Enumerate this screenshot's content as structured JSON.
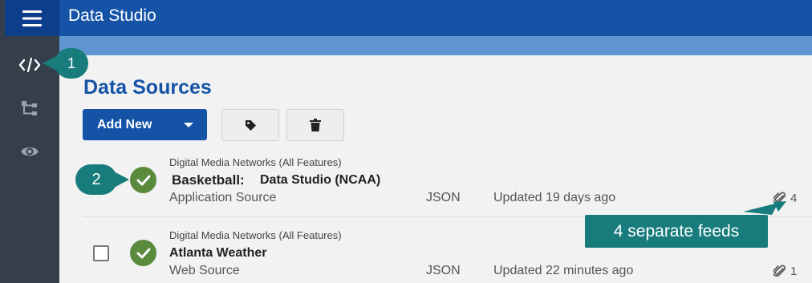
{
  "app": {
    "title": "Data Studio"
  },
  "sidebar": {
    "items": [
      {
        "icon": "code-icon"
      },
      {
        "icon": "tree-icon"
      },
      {
        "icon": "eye-icon"
      }
    ]
  },
  "page": {
    "title": "Data Sources"
  },
  "toolbar": {
    "add_label": "Add New"
  },
  "sources": [
    {
      "publisher": "Digital Media Networks (All Features)",
      "name_prefix": "Basketball:",
      "name": "Data Studio (NCAA)",
      "source_type": "Application Source",
      "format": "JSON",
      "updated": "Updated 19 days ago",
      "feed_count": "4"
    },
    {
      "publisher": "Digital Media Networks (All Features)",
      "name": "Atlanta Weather",
      "source_type": "Web Source",
      "format": "JSON",
      "updated": "Updated 22 minutes ago",
      "feed_count": "1"
    }
  ],
  "callouts": {
    "one": "1",
    "two": "2",
    "three": "4 separate feeds"
  },
  "colors": {
    "sidebar": "#353f4c",
    "topbar": "#1553a7",
    "menu": "#0d3e8c",
    "callout": "#187c7c",
    "status_ok": "#5a8a3c"
  }
}
